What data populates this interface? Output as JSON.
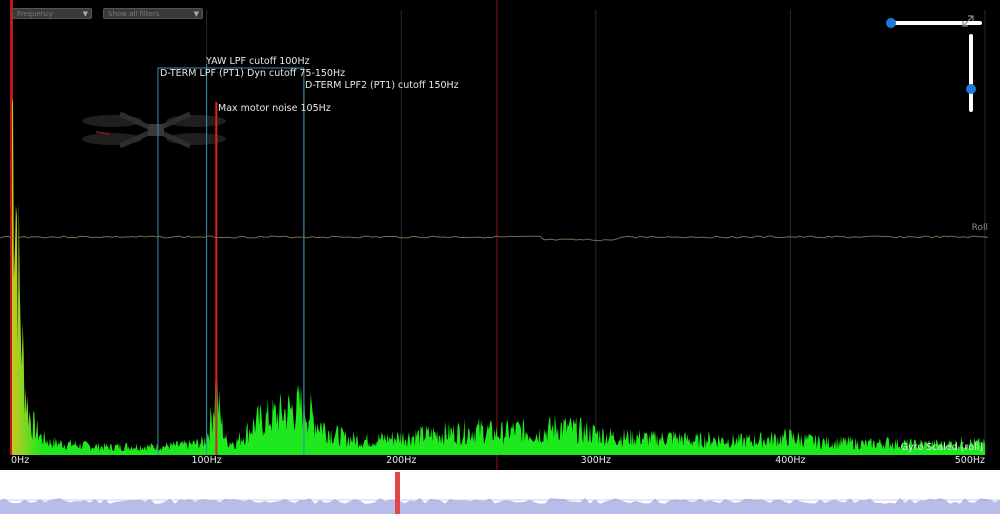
{
  "controls": {
    "type_select": "Frequency",
    "mode_select": "Show all filters"
  },
  "legend": {
    "series_label": "Gyro Scaled [roll]",
    "axis_label": "Roll"
  },
  "colors": {
    "spectrum": "#1ee81e",
    "spectrum_low": "#c8c820",
    "marker_red": "#e02020",
    "filter_line": "#3a8fb0",
    "accent": "#1e7ad6",
    "overview_fill": "#b7bde8"
  },
  "chart_data": {
    "type": "area",
    "title": "",
    "xlabel": "",
    "ylabel": "",
    "xlim": [
      0,
      500
    ],
    "x_ticks": [
      "0Hz",
      "100Hz",
      "200Hz",
      "300Hz",
      "400Hz",
      "500Hz"
    ],
    "x_tick_values": [
      0,
      100,
      200,
      300,
      400,
      500
    ],
    "grid": true,
    "filter_markers": [
      {
        "label": "YAW LPF cutoff 100Hz",
        "freq": 100,
        "color": "#3a8fb0"
      },
      {
        "label": "D-TERM LPF (PT1) Dyn cutoff 75-150Hz",
        "freq_min": 75,
        "freq_max": 150,
        "color": "#3a8fb0"
      },
      {
        "label": "D-TERM LPF2 (PT1) cutoff 150Hz",
        "freq": 150,
        "color": "#3a8fb0"
      },
      {
        "label": "Max motor noise 105Hz",
        "freq": 105,
        "color": "#e02020"
      }
    ],
    "series": [
      {
        "name": "Gyro Scaled [roll]",
        "x": [
          0,
          2,
          4,
          6,
          8,
          10,
          15,
          20,
          30,
          40,
          50,
          60,
          70,
          80,
          90,
          98,
          100,
          102,
          104,
          105,
          106,
          108,
          110,
          115,
          120,
          125,
          130,
          135,
          140,
          145,
          150,
          155,
          160,
          165,
          170,
          180,
          190,
          200,
          210,
          220,
          230,
          240,
          250,
          260,
          270,
          280,
          290,
          300,
          310,
          320,
          330,
          340,
          350,
          360,
          370,
          380,
          390,
          400,
          410,
          420,
          430,
          440,
          450,
          460,
          470,
          480,
          490,
          500
        ],
        "values": [
          100,
          75,
          42,
          24,
          14,
          9,
          5,
          3.5,
          3,
          2.5,
          2.2,
          2.5,
          2.3,
          2.5,
          2.8,
          3.5,
          5,
          9,
          16,
          20,
          14,
          8,
          4,
          3.5,
          6,
          9,
          10,
          11,
          12,
          13,
          14,
          10,
          8,
          6,
          5,
          4,
          4.5,
          5,
          5.5,
          6,
          6.5,
          7,
          6,
          7,
          6,
          8,
          7,
          6,
          5,
          5,
          4.5,
          5,
          4,
          4.5,
          4,
          4,
          4.5,
          5,
          4,
          3.5,
          3.5,
          3,
          3.5,
          3,
          3,
          3,
          3.5,
          3
        ]
      }
    ]
  }
}
